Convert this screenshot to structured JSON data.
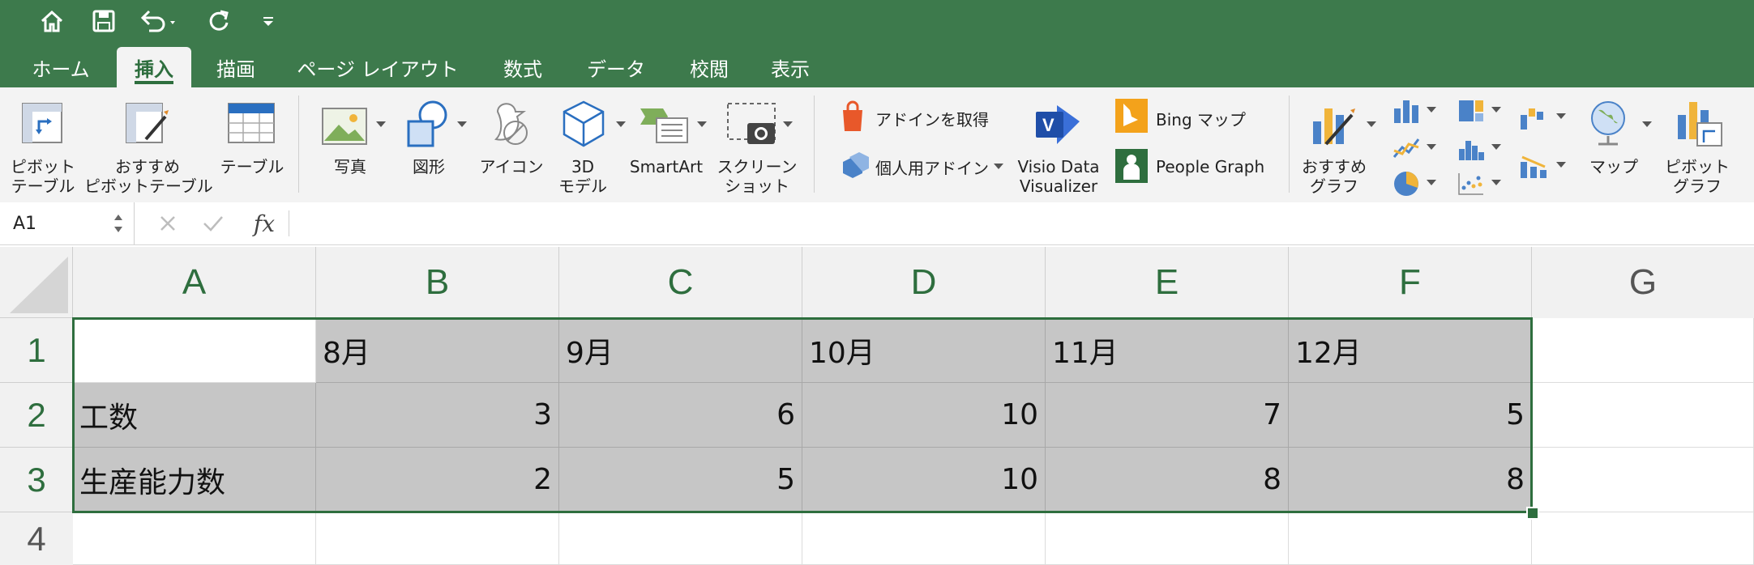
{
  "quick_access": {
    "home_icon": "home-icon",
    "save_icon": "save-icon",
    "undo_icon": "undo-icon",
    "redo_icon": "redo-icon",
    "customize_icon": "chevron-down-icon"
  },
  "tabs": [
    "ホーム",
    "挿入",
    "描画",
    "ページ レイアウト",
    "数式",
    "データ",
    "校閲",
    "表示"
  ],
  "active_tab": "挿入",
  "ribbon": {
    "pivot_table": [
      "ピボット",
      "テーブル"
    ],
    "recommended_pivot": [
      "おすすめ",
      "ピボットテーブル"
    ],
    "table": "テーブル",
    "pictures": "写真",
    "shapes": "図形",
    "icons": "アイコン",
    "model3d": [
      "3D",
      "モデル"
    ],
    "smartart": "SmartArt",
    "screenshot": [
      "スクリーン",
      "ショット"
    ],
    "get_addins": "アドインを取得",
    "my_addins": "個人用アドイン",
    "visio": [
      "Visio Data",
      "Visualizer"
    ],
    "bing_maps": "Bing マップ",
    "people_graph": "People Graph",
    "recommended_charts": [
      "おすすめ",
      "グラフ"
    ],
    "maps": "マップ",
    "pivot_chart": [
      "ピボット",
      "グラフ"
    ]
  },
  "formula_bar": {
    "name_box": "A1",
    "cancel_icon": "close-icon",
    "enter_icon": "check-icon",
    "fx": "fx",
    "formula": ""
  },
  "columns": [
    "A",
    "B",
    "C",
    "D",
    "E",
    "F",
    "G"
  ],
  "rows": [
    "1",
    "2",
    "3",
    "4"
  ],
  "cells": {
    "r1": [
      "",
      "8月",
      "9月",
      "10月",
      "11月",
      "12月"
    ],
    "r2": [
      "工数",
      "3",
      "6",
      "10",
      "7",
      "5"
    ],
    "r3": [
      "生産能力数",
      "2",
      "5",
      "10",
      "8",
      "8"
    ]
  },
  "colors": {
    "title_bar": "#3d7a4c",
    "accent": "#2e6e3e",
    "selection_fill": "#c6c6c6"
  }
}
